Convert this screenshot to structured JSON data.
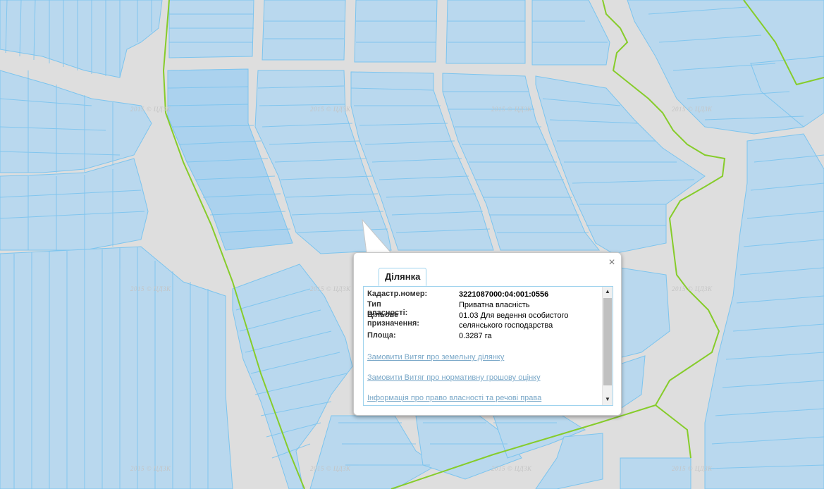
{
  "map": {
    "watermark_text": "2015 © ЦДЗК",
    "colors": {
      "background": "#dedede",
      "parcel_fill": "#b9d8ee",
      "parcel_fill_selected": "#a6d0ef",
      "parcel_stroke": "#7cc4ee",
      "boundary": "#86cc2a"
    }
  },
  "popup": {
    "tab_label": "Ділянка",
    "close_icon": "close-icon",
    "fields": [
      {
        "label": "Кадастр.номер:",
        "value": "3221087000:04:001:0556",
        "bold": true
      },
      {
        "label": "Тип власності:",
        "value": "Приватна власність"
      },
      {
        "label": "Цільове призначення:",
        "value": "01.03 Для ведення особистого селянського господарства"
      },
      {
        "label": "Площа:",
        "value": "0.3287 га"
      }
    ],
    "links": [
      "Замовити Витяг про земельну ділянку",
      "Замовити Витяг про нормативну грошову оцінку",
      "Інформація про право власності та речові права"
    ]
  }
}
